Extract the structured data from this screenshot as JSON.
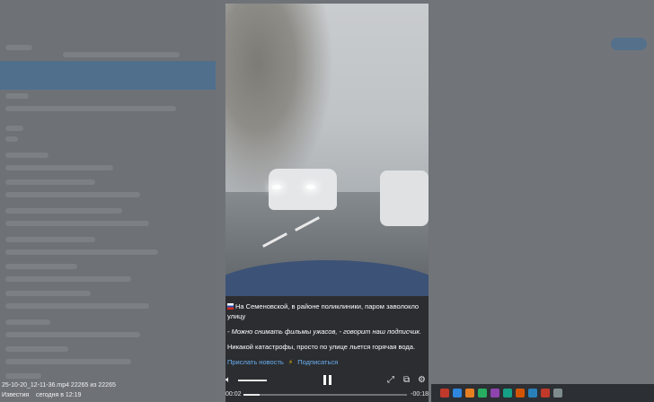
{
  "caption": {
    "line1": "На Семеновской, в районе поликлиники, паром заволокло улицу",
    "line2": "- Можно снимать фильмы ужасов, - говорит наш подписчик.",
    "line3": "Никакой катастрофы, просто по улице льется горячая вода.",
    "link_send": "Прислать новость",
    "link_subscribe": "Подписаться"
  },
  "player": {
    "current_time": "00:02",
    "remaining_time": "-00:18",
    "progress": 0.1
  },
  "file_info": {
    "name": "25-10-20_12-11-36.mp4 22265 из 22265",
    "sender": "Известия",
    "date": "сегодня в 12:19"
  },
  "icons": {
    "flag": "russia-flag-icon",
    "bolt": "lightning-icon",
    "volume": "volume-icon",
    "pause": "pause-icon",
    "fullscreen": "fullscreen-icon",
    "pip": "picture-in-picture-icon",
    "settings": "gear-icon"
  },
  "colors": {
    "link": "#6ab0f3",
    "hood": "#3c5276"
  }
}
